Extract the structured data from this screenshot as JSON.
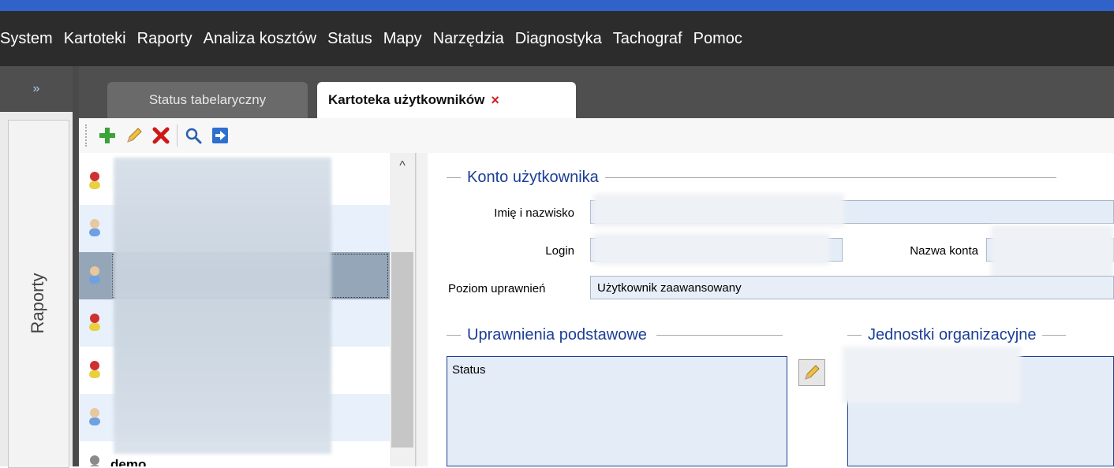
{
  "menu": {
    "items": [
      "System",
      "Kartoteki",
      "Raporty",
      "Analiza kosztów",
      "Status",
      "Mapy",
      "Narzędzia",
      "Diagnostyka",
      "Tachograf",
      "Pomoc"
    ]
  },
  "side": {
    "expand_glyph": "»",
    "label": "Raporty"
  },
  "tabs": [
    {
      "label": "Status tabelaryczny",
      "active": false
    },
    {
      "label": "Kartoteka użytkowników",
      "active": true,
      "close_glyph": "×"
    }
  ],
  "toolbar": {
    "buttons": [
      "add-icon",
      "edit-icon",
      "delete-icon",
      "search-icon",
      "export-icon"
    ]
  },
  "user_list": {
    "rows": [
      {
        "icon": "user-red-icon"
      },
      {
        "icon": "user-blue-icon"
      },
      {
        "icon": "user-blue-icon",
        "selected": true
      },
      {
        "icon": "user-red-icon"
      },
      {
        "icon": "user-red-icon"
      },
      {
        "icon": "user-blue-icon"
      },
      {
        "icon": "user-icon",
        "name": "demo"
      }
    ],
    "scroll_up_glyph": "^"
  },
  "account": {
    "title": "Konto użytkownika",
    "name_label": "Imię i nazwisko",
    "login_label": "Login",
    "account_name_label": "Nazwa konta",
    "permission_level_label": "Poziom uprawnień",
    "permission_level_value": "Użytkownik zaawansowany"
  },
  "basic_permissions": {
    "title": "Uprawnienia podstawowe",
    "items": [
      "Status"
    ]
  },
  "org_units": {
    "title": "Jednostki organizacyjne"
  },
  "colors": {
    "accent": "#2f63c9",
    "menubar": "#2c2c2c",
    "group_title": "#1b3e95",
    "field_bg": "#e4ecf7"
  }
}
